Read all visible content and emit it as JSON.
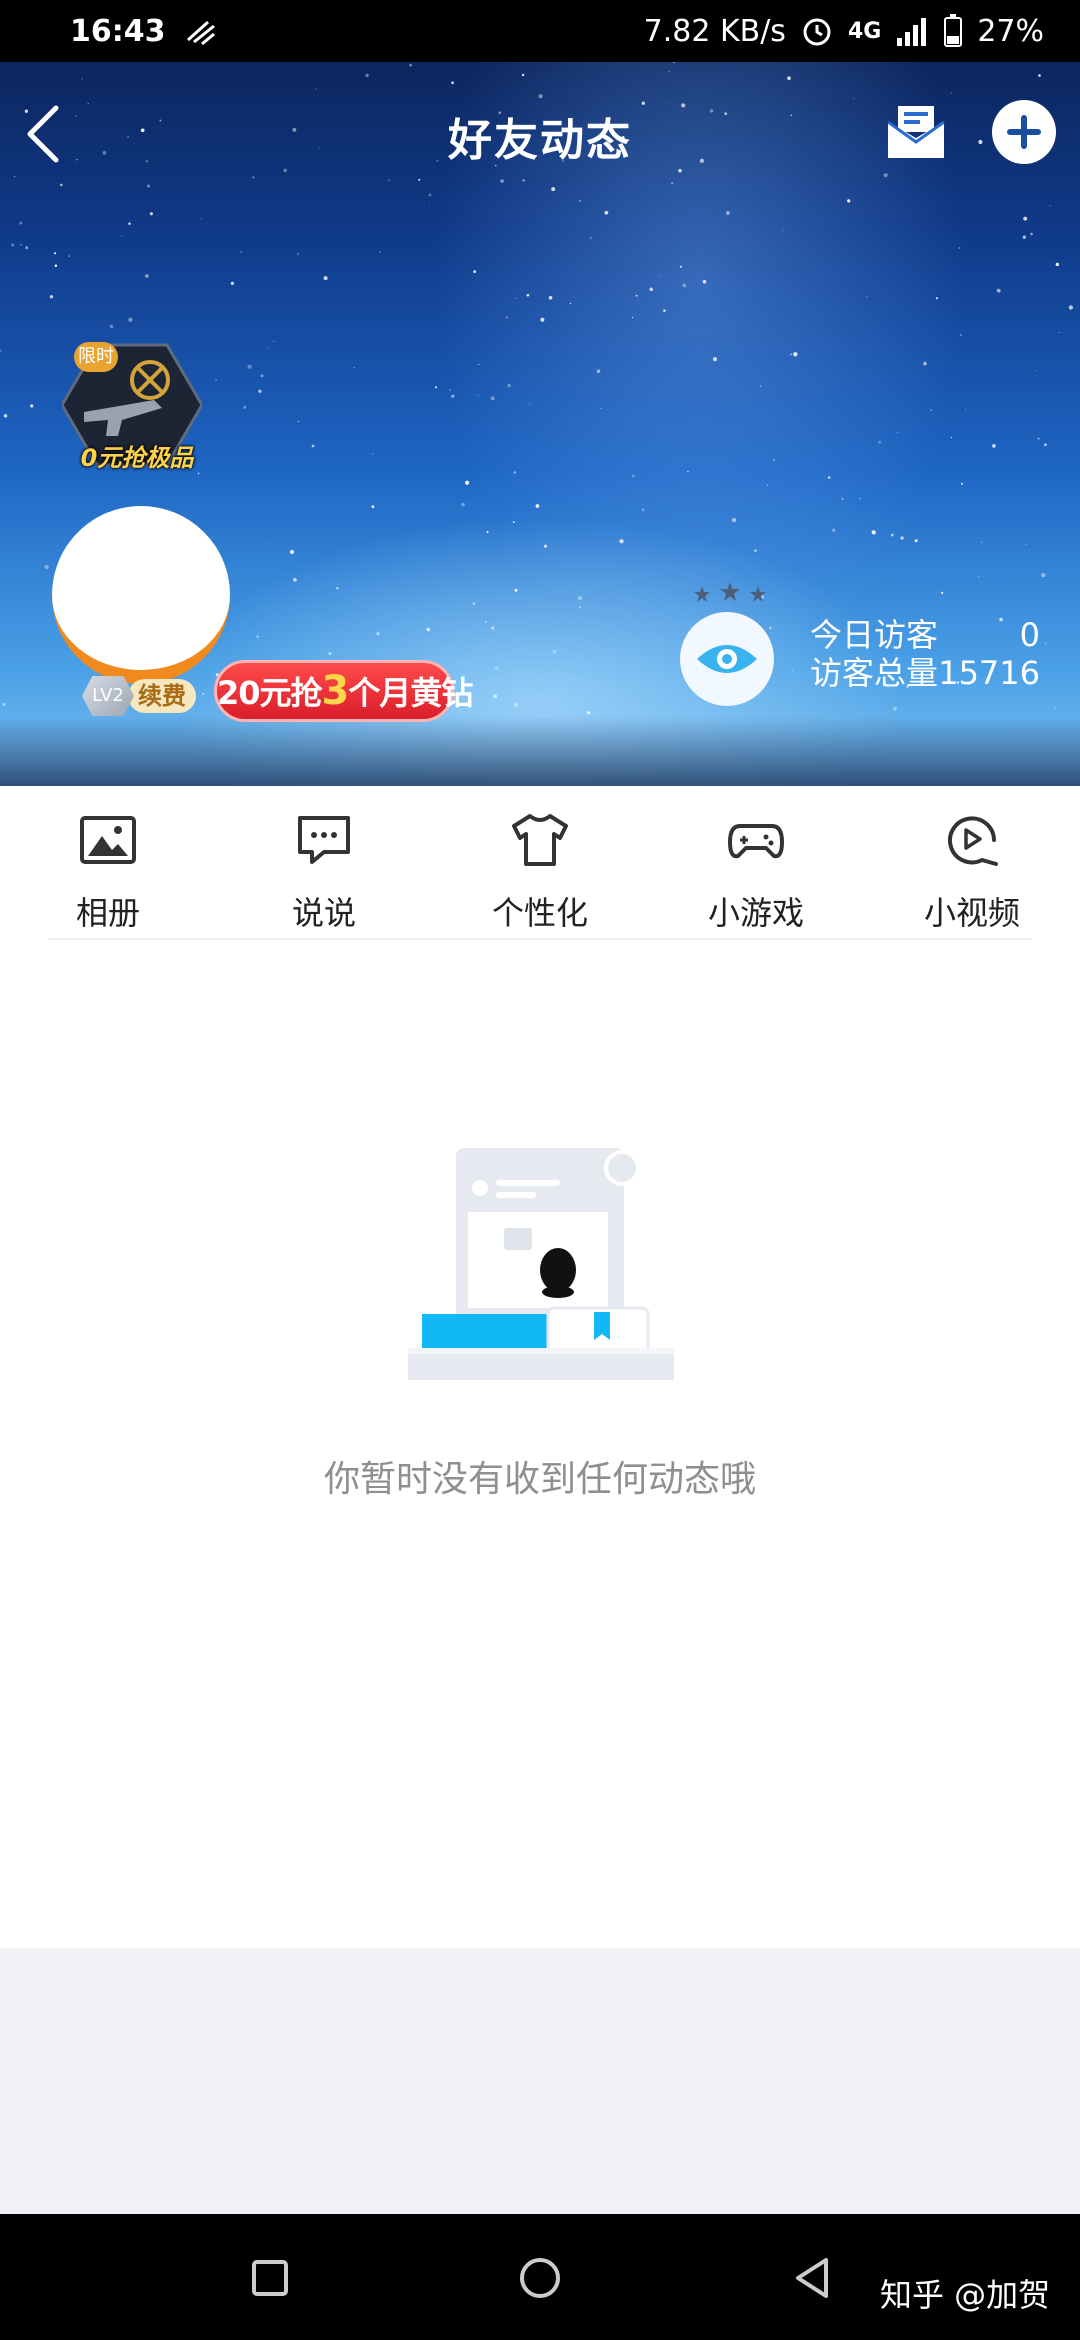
{
  "status_bar": {
    "time": "16:43",
    "net_speed": "7.82 KB/s",
    "network": "4G",
    "battery": "27%"
  },
  "nav": {
    "title": "好友动态"
  },
  "profile": {
    "promo_tag": "限时",
    "promo_text": "0元抢极品",
    "level": "LV2",
    "renew_label": "续费",
    "vip_banner_prefix": "20元抢",
    "vip_banner_number": "3",
    "vip_banner_suffix": "个月黄钻"
  },
  "visitors": {
    "today_label": "今日访客",
    "today_value": "0",
    "total_label": "访客总量",
    "total_value": "15716"
  },
  "features": [
    {
      "label": "相册",
      "icon": "photo-album-icon"
    },
    {
      "label": "说说",
      "icon": "chat-bubble-icon"
    },
    {
      "label": "个性化",
      "icon": "tshirt-icon"
    },
    {
      "label": "小游戏",
      "icon": "gamepad-icon"
    },
    {
      "label": "小视频",
      "icon": "video-play-icon"
    }
  ],
  "empty_state": {
    "message": "你暂时没有收到任何动态哦"
  },
  "watermark": "知乎 @加贺",
  "colors": {
    "accent_blue": "#12b7f5",
    "vip_red": "#e02a2f",
    "avatar_ring": "#f08a1c",
    "empty_text": "#8e8e93"
  }
}
